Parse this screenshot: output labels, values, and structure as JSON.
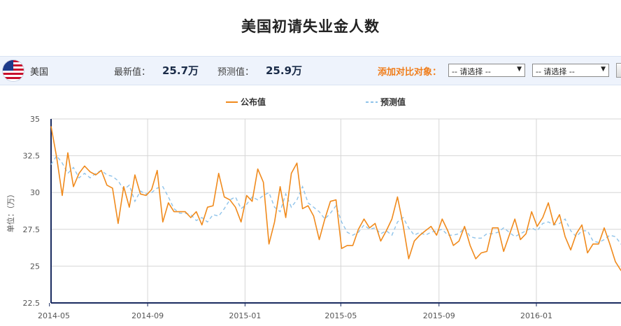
{
  "header": {
    "title": "美国初请失业金人数"
  },
  "info": {
    "country": "美国",
    "latest_label": "最新值：",
    "latest_value": "25.7万",
    "forecast_label": "预测值：",
    "forecast_value": "25.9万",
    "compare_label": "添加对比对象：",
    "select1": "-- 请选择 --",
    "select2": "-- 请选择 --"
  },
  "colors": {
    "published": "#f08a1c",
    "forecast": "#8fc3ea",
    "axis": "#1a2b60",
    "grid": "#d6d6d6"
  },
  "chart_data": {
    "type": "line",
    "title": "",
    "ylabel": "单位：（万）",
    "ylim": [
      22.5,
      35
    ],
    "yticks": [
      "22.5",
      "25",
      "27.5",
      "30",
      "32.5",
      "35"
    ],
    "x_start": "2014-05-03",
    "x_end": "2016-04-16",
    "xtick_labels": [
      "2014-05",
      "2014-09",
      "2015-01",
      "2015-05",
      "2015-09",
      "2016-01"
    ],
    "xtick_dates": [
      "2014-05-01",
      "2014-09-01",
      "2015-01-01",
      "2015-05-01",
      "2015-09-01",
      "2016-01-01"
    ],
    "legend": [
      "公布值",
      "预测值"
    ],
    "series": [
      {
        "name": "公布值",
        "values": [
          34.5,
          32.4,
          29.8,
          32.7,
          30.4,
          31.3,
          31.8,
          31.4,
          31.2,
          31.5,
          30.5,
          30.3,
          27.9,
          30.4,
          29.0,
          31.2,
          29.9,
          29.8,
          30.2,
          31.5,
          28.0,
          29.3,
          28.7,
          28.7,
          28.7,
          28.3,
          28.7,
          27.8,
          29.0,
          29.1,
          31.3,
          29.7,
          29.5,
          29.0,
          28.0,
          29.8,
          29.4,
          31.6,
          30.7,
          26.5,
          28.0,
          30.4,
          28.3,
          31.3,
          32.0,
          28.9,
          29.1,
          28.4,
          26.8,
          28.2,
          29.4,
          29.5,
          26.2,
          26.4,
          26.4,
          27.5,
          28.2,
          27.6,
          27.9,
          26.7,
          27.4,
          28.2,
          29.7,
          27.8,
          25.5,
          26.7,
          27.1,
          27.4,
          27.7,
          27.1,
          28.2,
          27.4,
          26.4,
          26.7,
          27.7,
          26.4,
          25.5,
          25.9,
          26.0,
          27.6,
          27.6,
          26.0,
          27.1,
          28.2,
          26.8,
          27.2,
          28.7,
          27.7,
          28.3,
          29.3,
          27.8,
          28.5,
          27.0,
          26.1,
          27.2,
          27.8,
          25.9,
          26.5,
          26.5,
          27.6,
          26.5,
          25.3,
          24.7,
          25.5
        ]
      },
      {
        "name": "预测值",
        "values": [
          31.9,
          32.5,
          32.0,
          31.3,
          31.7,
          31.0,
          31.3,
          31.0,
          31.3,
          31.5,
          31.2,
          31.1,
          30.8,
          30.2,
          30.5,
          29.4,
          30.1,
          29.9,
          30.0,
          30.3,
          30.4,
          29.7,
          28.9,
          28.6,
          28.6,
          28.5,
          28.1,
          28.3,
          28.0,
          28.5,
          28.4,
          28.9,
          29.5,
          29.7,
          28.9,
          29.2,
          29.7,
          29.5,
          29.8,
          30.0,
          29.0,
          28.7,
          29.9,
          29.0,
          29.5,
          30.4,
          29.3,
          29.0,
          28.7,
          28.2,
          28.6,
          29.1,
          28.0,
          27.3,
          27.1,
          27.3,
          27.8,
          27.5,
          27.6,
          27.2,
          27.4,
          27.1,
          28.0,
          28.3,
          27.6,
          27.1,
          27.3,
          27.1,
          27.3,
          27.4,
          27.5,
          27.1,
          27.1,
          27.2,
          27.6,
          27.0,
          26.9,
          26.9,
          27.2,
          27.2,
          27.3,
          27.6,
          27.3,
          27.0,
          27.2,
          27.4,
          27.6,
          27.4,
          27.9,
          28.0,
          27.8,
          27.9,
          28.2,
          27.4,
          27.0,
          27.4,
          27.4,
          26.7,
          26.6,
          26.8,
          27.1,
          27.0,
          26.5,
          26.0
        ]
      }
    ]
  }
}
